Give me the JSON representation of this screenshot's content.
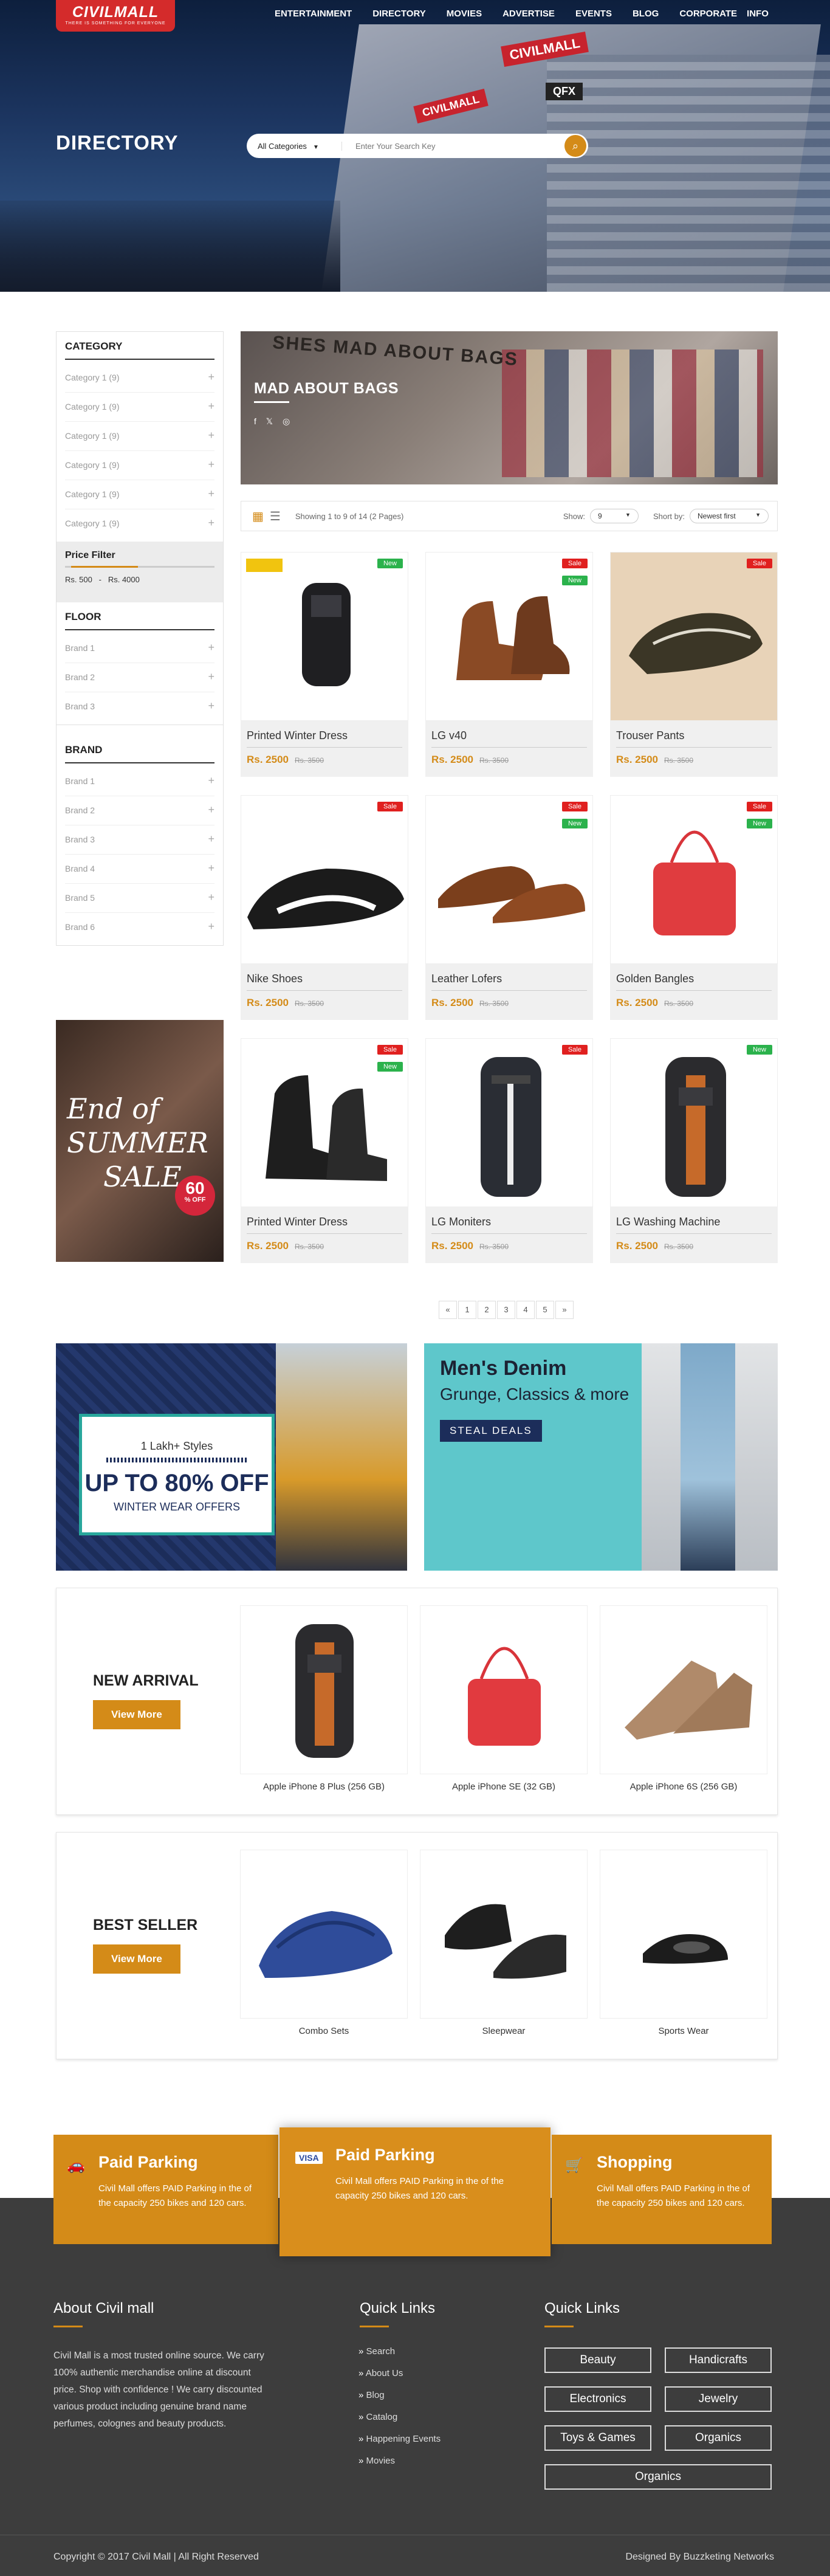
{
  "logo": {
    "name": "CIVILMALL",
    "tagline": "THERE IS SOMETHING FOR EVERYONE"
  },
  "nav": [
    "ENTERTAINMENT",
    "DIRECTORY",
    "MOVIES",
    "ADVERTISE",
    "EVENTS",
    "BLOG",
    "CORPORATE",
    "INFO"
  ],
  "hero": {
    "title": "DIRECTORY",
    "signs": [
      "CIVILMALL",
      "CIVILMALL",
      "QFX"
    ]
  },
  "search": {
    "category": "All Categories",
    "placeholder": "Enter Your Search Key"
  },
  "sidebar": {
    "category_title": "CATEGORY",
    "categories": [
      "Category 1 (9)",
      "Category 1 (9)",
      "Category 1 (9)",
      "Category 1 (9)",
      "Category 1 (9)",
      "Category 1 (9)"
    ],
    "price_title": "Price Filter",
    "price_min": "Rs. 500",
    "price_sep": "-",
    "price_max": "Rs. 4000",
    "price_range": [
      500,
      4000
    ],
    "floor_title": "FLOOR",
    "floors": [
      "Brand 1",
      "Brand 2",
      "Brand 3"
    ],
    "brand_title": "BRAND",
    "brands": [
      "Brand 1",
      "Brand 2",
      "Brand 3",
      "Brand 4",
      "Brand 5",
      "Brand 6"
    ]
  },
  "promo_side": {
    "line1": "End of",
    "line2": "SUMMER",
    "line3": "SALE",
    "pct": "60",
    "off": "% OFF"
  },
  "banner": {
    "title": "MAD ABOUT BAGS",
    "social": "f 𝕏 ◎",
    "sign": "SHES MAD ABOUT BAGS"
  },
  "toolbar": {
    "showing": "Showing 1 to 9 of 14 (2 Pages)",
    "show_label": "Show:",
    "show_value": "9",
    "sort_label": "Short by:",
    "sort_value": "Newest first"
  },
  "products": [
    {
      "name": "Printed Winter Dress",
      "price": "Rs. 2500",
      "old": "Rs. 3500",
      "sale": false,
      "new": true,
      "brand": "CAT"
    },
    {
      "name": "LG v40",
      "price": "Rs. 2500",
      "old": "Rs. 3500",
      "sale": true,
      "new": true
    },
    {
      "name": "Trouser Pants",
      "price": "Rs. 2500",
      "old": "Rs. 3500",
      "sale": true,
      "new": false
    },
    {
      "name": "Nike Shoes",
      "price": "Rs. 2500",
      "old": "Rs. 3500",
      "sale": true,
      "new": false
    },
    {
      "name": "Leather Lofers",
      "price": "Rs. 2500",
      "old": "Rs. 3500",
      "sale": true,
      "new": true
    },
    {
      "name": "Golden Bangles",
      "price": "Rs. 2500",
      "old": "Rs. 3500",
      "sale": true,
      "new": true
    },
    {
      "name": "Printed Winter Dress",
      "price": "Rs. 2500",
      "old": "Rs. 3500",
      "sale": true,
      "new": true
    },
    {
      "name": "LG Moniters",
      "price": "Rs. 2500",
      "old": "Rs. 3500",
      "sale": true,
      "new": false
    },
    {
      "name": "LG Washing Machine",
      "price": "Rs. 2500",
      "old": "Rs. 3500",
      "sale": false,
      "new": true
    }
  ],
  "sale_label": "Sale",
  "new_label": "New",
  "pager": [
    "«",
    "1",
    "2",
    "3",
    "4",
    "5",
    "»"
  ],
  "ad_winter": {
    "line1": "1 Lakh+ Styles",
    "line2": "UP TO 80% OFF",
    "line3": "WINTER WEAR OFFERS"
  },
  "ad_denim": {
    "line1": "Men's Denim",
    "line2": "Grunge, Classics & more",
    "button": "STEAL DEALS"
  },
  "new_arrival": {
    "title": "NEW ARRIVAL",
    "button": "View More",
    "items": [
      "Apple iPhone 8 Plus (256 GB)",
      "Apple iPhone SE (32 GB)",
      "Apple iPhone 6S (256 GB)"
    ]
  },
  "best_seller": {
    "title": "BEST SELLER",
    "button": "View More",
    "items": [
      "Combo Sets",
      "Sleepwear",
      "Sports Wear"
    ]
  },
  "parking": [
    {
      "title": "Paid Parking",
      "text": "Civil Mall offers PAID Parking in the of the capacity 250 bikes and 120 cars.",
      "icon": "car-icon"
    },
    {
      "title": "Paid Parking",
      "text": "Civil Mall offers PAID Parking in the of the capacity 250 bikes and 120 cars.",
      "icon": "visa-icon",
      "badge": "VISA"
    },
    {
      "title": "Shopping",
      "text": "Civil Mall offers PAID Parking in the of the capacity 250 bikes and 120 cars.",
      "icon": "cart-icon"
    }
  ],
  "footer": {
    "about_title": "About Civil mall",
    "about_text": "Civil Mall is a most trusted online source. We carry 100% authentic merchandise online at discount price. Shop with confidence ! We carry discounted various product including genuine brand name perfumes, colognes and beauty products.",
    "links_title": "Quick Links",
    "links": [
      "Search",
      "About Us",
      "Blog",
      "Catalog",
      "Happening Events",
      "Movies"
    ],
    "tags_title": "Quick Links",
    "tags": [
      "Beauty",
      "Handicrafts",
      "Electronics",
      "Jewelry",
      "Toys & Games",
      "Organics",
      "Organics"
    ],
    "copyright": "Copyright  ©  2017 Civil Mall | All Right Reserved",
    "designed": "Designed By Buzzketing Networks"
  },
  "colors": {
    "accent": "#d48b18",
    "sale": "#e0201f",
    "new": "#2bb24c",
    "footer": "#3d3d3d"
  }
}
